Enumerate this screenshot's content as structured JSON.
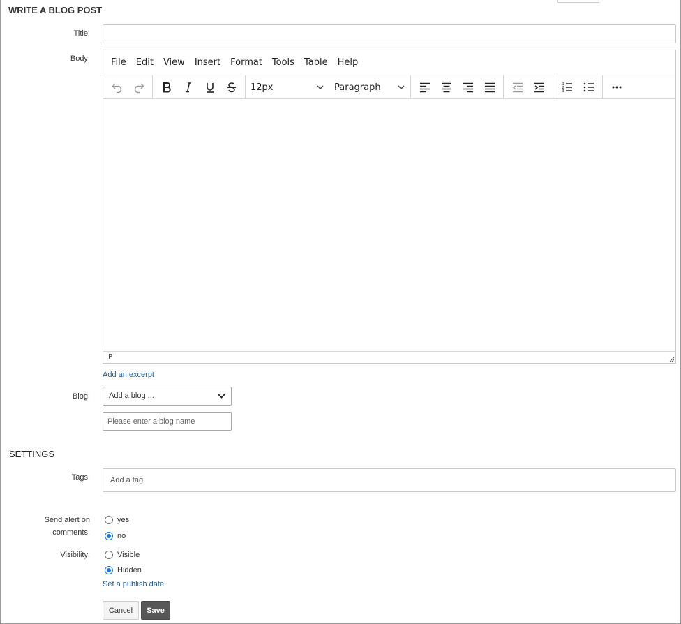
{
  "form": {
    "heading": "WRITE A BLOG POST",
    "title_label": "Title:",
    "title_value": "",
    "body_label": "Body:"
  },
  "editor": {
    "menu": [
      "File",
      "Edit",
      "View",
      "Insert",
      "Format",
      "Tools",
      "Table",
      "Help"
    ],
    "font_size": "12px",
    "block_format": "Paragraph",
    "status_path": "P",
    "icons": {
      "undo": "undo-icon",
      "redo": "redo-icon",
      "bold": "bold-icon",
      "italic": "italic-icon",
      "underline": "underline-icon",
      "strike": "strikethrough-icon",
      "align_left": "align-left-icon",
      "align_center": "align-center-icon",
      "align_right": "align-right-icon",
      "justify": "align-justify-icon",
      "outdent": "outdent-icon",
      "indent": "indent-icon",
      "numlist": "numbered-list-icon",
      "bullist": "bullet-list-icon",
      "more": "more-icon"
    }
  },
  "excerpt_link": "Add an excerpt",
  "blog": {
    "label": "Blog:",
    "selected": "Add a blog ...",
    "name_placeholder": "Please enter a blog name"
  },
  "settings": {
    "heading": "SETTINGS",
    "tags_label": "Tags:",
    "tags_placeholder": "Add a tag",
    "alert_label_line1": "Send alert on",
    "alert_label_line2": "comments:",
    "alert_options": [
      {
        "label": "yes",
        "checked": false
      },
      {
        "label": "no",
        "checked": true
      }
    ],
    "visibility_label": "Visibility:",
    "visibility_options": [
      {
        "label": "Visible",
        "checked": false
      },
      {
        "label": "Hidden",
        "checked": true
      }
    ],
    "publish_date_link": "Set a publish date"
  },
  "actions": {
    "cancel": "Cancel",
    "save": "Save"
  },
  "colors": {
    "link": "#1f5c99",
    "radio_checked": "#1a73e8",
    "save_button": "#585858"
  }
}
